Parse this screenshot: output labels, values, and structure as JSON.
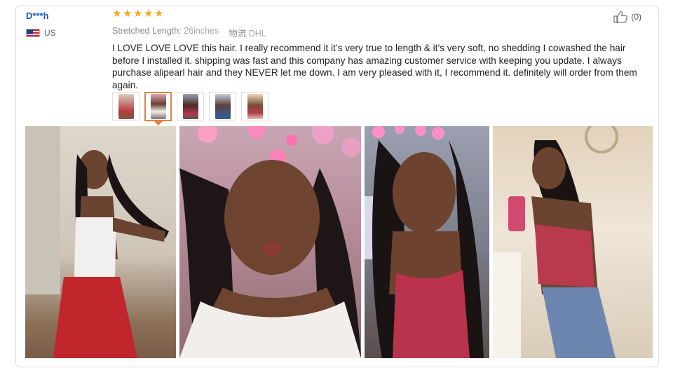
{
  "review": {
    "username": "D***h",
    "country": "US",
    "rating": 5,
    "stretched_length_label": "Stretched Length:",
    "stretched_length_value": "26inches",
    "shipping_label": "物流",
    "shipping_value": "DHL",
    "text": "I LOVE LOVE LOVE this hair. I really recommend it it’s very true to length & it’s very soft, no shedding I cowashed the hair before I installed it. shipping was fast and this company has amazing customer service with keeping you update. I always purchase alipearl hair and they NEVER let me down. I am very pleased with it, I recommend it. definitely will order from them again.",
    "helpful_count": "(0)"
  },
  "icons": {
    "star": "star-icon",
    "thumbs_up": "thumbs-up-icon",
    "flag": "us-flag-icon"
  },
  "colors": {
    "username": "#1a5fa8",
    "star": "#f6a623",
    "active_thumb_border": "#e4823c"
  },
  "thumbnails": [
    {
      "index": 1,
      "active": false
    },
    {
      "index": 2,
      "active": true
    },
    {
      "index": 3,
      "active": false
    },
    {
      "index": 4,
      "active": false
    },
    {
      "index": 5,
      "active": false
    }
  ],
  "photos": [
    {
      "index": 1,
      "alt": ""
    },
    {
      "index": 2,
      "alt": ""
    },
    {
      "index": 3,
      "alt": ""
    },
    {
      "index": 4,
      "alt": ""
    }
  ]
}
